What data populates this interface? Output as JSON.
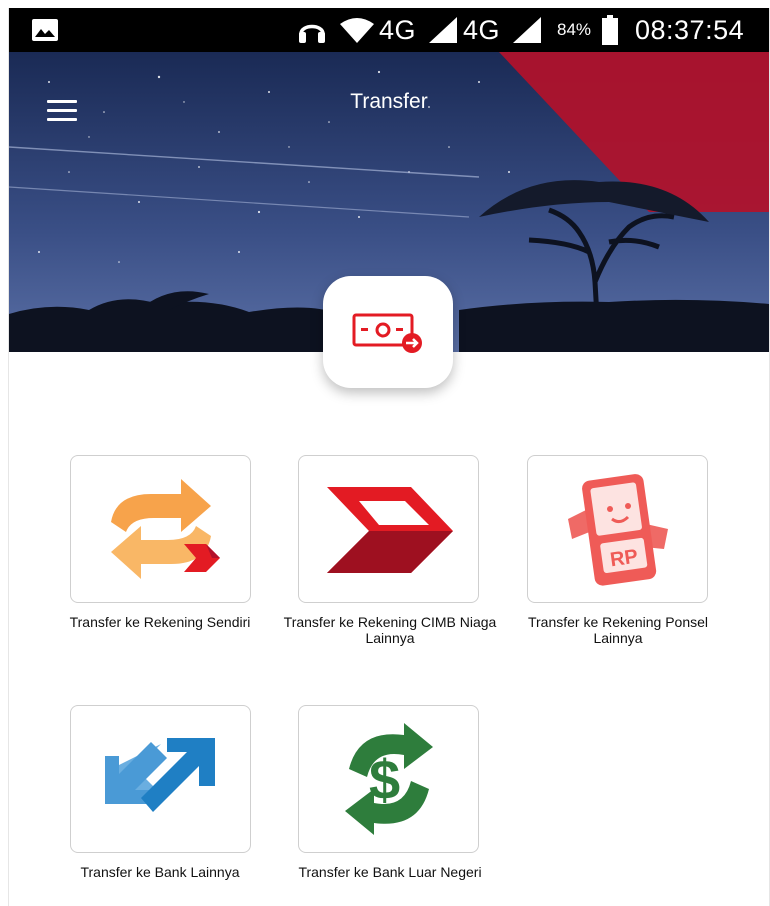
{
  "status_bar": {
    "network1": "4G",
    "network2": "4G",
    "battery": "84%",
    "time": "08:37:54"
  },
  "header": {
    "title": "Transfer"
  },
  "menu": [
    {
      "label": "Transfer ke Rekening Sendiri",
      "icon": "own-account-transfer-icon"
    },
    {
      "label": "Transfer ke Rekening CIMB Niaga Lainnya",
      "icon": "cimb-niaga-icon"
    },
    {
      "label": "Transfer ke Rekening Ponsel Lainnya",
      "icon": "mobile-account-rp-icon"
    },
    {
      "label": "Transfer ke Bank Lainnya",
      "icon": "other-bank-arrows-icon"
    },
    {
      "label": "Transfer ke Bank Luar Negeri",
      "icon": "foreign-dollar-icon"
    }
  ],
  "colors": {
    "brand_red": "#e31b23",
    "orange": "#f7a34b",
    "blue": "#2a8fd0",
    "green": "#2e7d3c"
  }
}
